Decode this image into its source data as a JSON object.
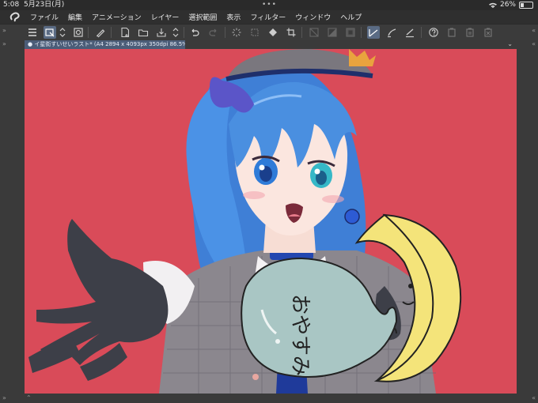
{
  "status_bar": {
    "time": "5:08",
    "date": "5月23日(月)",
    "battery": "26%",
    "battery_level": 0.26,
    "multitask_dots": "•••"
  },
  "menu": {
    "items": [
      "ファイル",
      "編集",
      "アニメーション",
      "レイヤー",
      "選択範囲",
      "表示",
      "フィルター",
      "ウィンドウ",
      "ヘルプ"
    ]
  },
  "toolbar": {
    "icons": [
      "menu-icon",
      "select-layer-icon",
      "up-down-icon",
      "navigator-icon",
      "pen-icon",
      "new-file-icon",
      "open-folder-icon",
      "save-icon",
      "up-down-icon",
      "undo-icon",
      "redo-icon",
      "loading-icon",
      "transform-icon",
      "fill-icon",
      "crop-icon",
      "clear-icon",
      "fill-selection-icon",
      "invert-icon",
      "ruler-icon",
      "stroke-icon",
      "correct-line-icon",
      "help-icon",
      "copy-icon",
      "paste-icon",
      "delete-icon"
    ]
  },
  "document": {
    "tab_title": "イ星街すいせいラスト* (A4 2894 x 4093px 350dpi 86.5%)"
  },
  "artwork": {
    "speech_bubble_text": "おやすみ",
    "colors": {
      "background": "#d94b59",
      "hair": "#4a8fe0",
      "moon": "#f4e47a",
      "bubble": "#a9c6c4",
      "jacket": "#8e8a90",
      "glove": "#3d3f48"
    }
  }
}
